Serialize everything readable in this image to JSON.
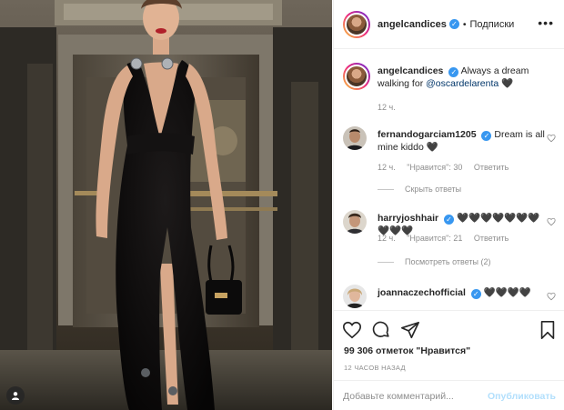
{
  "post": {
    "author": "angelcandices",
    "follow_state": "Подписки",
    "separator": "•",
    "caption": "Always a dream walking for",
    "caption_mention": "@oscardelarenta",
    "caption_emoji": "🖤",
    "caption_time": "12 ч."
  },
  "comments": [
    {
      "user": "fernandogarciam1205",
      "verified": true,
      "text": "Dream is all mine kiddo",
      "emoji": "🖤",
      "time": "12 ч.",
      "likes": "\"Нравится\": 30",
      "reply": "Ответить",
      "thread": "Скрыть ответы"
    },
    {
      "user": "harryjoshhair",
      "verified": true,
      "text": "🖤🖤🖤🖤🖤🖤🖤🖤🖤🖤",
      "time": "12 ч.",
      "likes": "\"Нравится\": 21",
      "reply": "Ответить",
      "thread": "Посмотреть ответы (2)"
    },
    {
      "user": "joannaczechofficial",
      "verified": true,
      "text": "🖤🖤🖤🖤"
    }
  ],
  "stats": {
    "likes": "99 306 отметок \"Нравится\"",
    "timestamp": "12 ЧАСОВ НАЗАД"
  },
  "composer": {
    "placeholder": "Добавьте комментарий...",
    "publish": "Опубликовать"
  },
  "icons": {
    "like": "heart-icon",
    "comment": "comment-icon",
    "share": "share-icon",
    "save": "bookmark-icon",
    "more": "more-icon",
    "tags": "user-tag-icon"
  },
  "colors": {
    "verified": "#3897f0",
    "mention": "#003569",
    "publish_disabled": "#b2dffc",
    "muted": "#8e8e8e"
  }
}
